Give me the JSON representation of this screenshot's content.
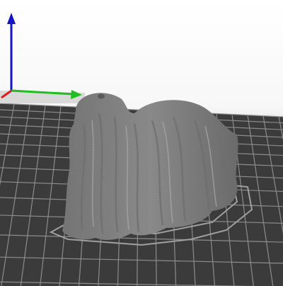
{
  "viewport": {
    "background": "#f2f2f2",
    "bed_color": "#3a3a3a",
    "grid_color": "#8a8a8a",
    "model_color": "#8f8f8f"
  },
  "axes": {
    "x_color": "#1fbf1f",
    "y_color": "#e01b1b",
    "z_color": "#1414c8"
  }
}
